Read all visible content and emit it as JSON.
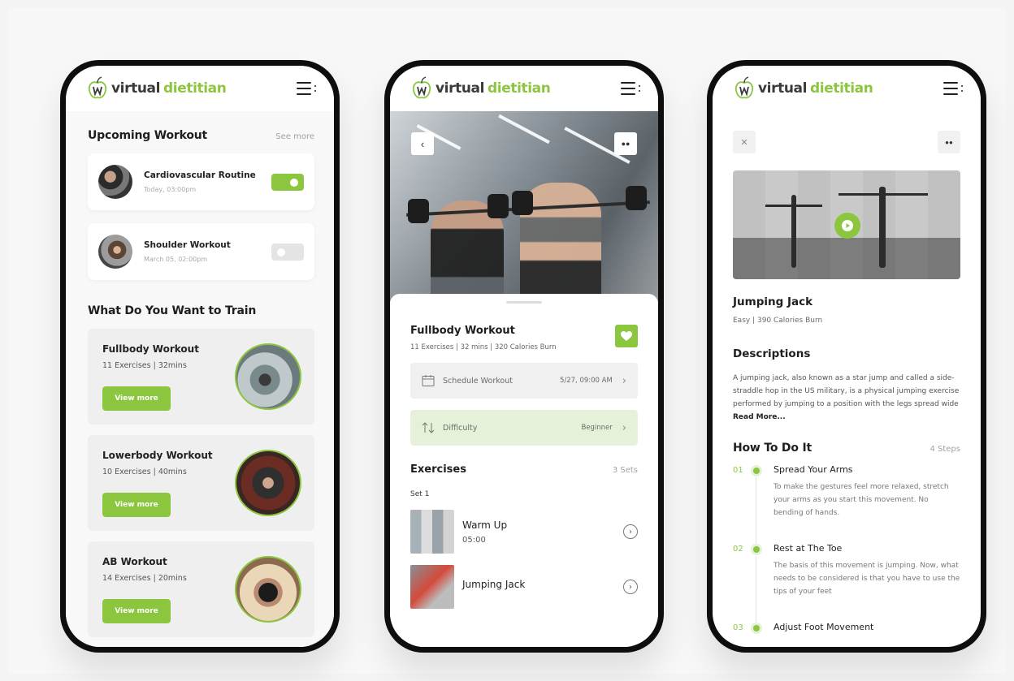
{
  "brand": {
    "word1": "virtual",
    "word2": "dietitian"
  },
  "colors": {
    "accent": "#8cc63f",
    "accent_light": "#e6f1d9"
  },
  "screen1": {
    "upcoming_title": "Upcoming Workout",
    "see_more": "See more",
    "workouts": [
      {
        "name": "Cardiovascular Routine",
        "time": "Today, 03:00pm",
        "enabled": true
      },
      {
        "name": "Shoulder Workout",
        "time": "March 05, 02:00pm",
        "enabled": false
      }
    ],
    "train_title": "What Do You Want to Train",
    "trainings": [
      {
        "name": "Fullbody Workout",
        "meta": "11 Exercises | 32mins",
        "button": "View more"
      },
      {
        "name": "Lowerbody Workout",
        "meta": "10 Exercises | 40mins",
        "button": "View more"
      },
      {
        "name": "AB Workout",
        "meta": "14 Exercises | 20mins",
        "button": "View more"
      }
    ]
  },
  "screen2": {
    "title": "Fullbody Workout",
    "meta": "11 Exercises | 32 mins | 320 Calories Burn",
    "schedule": {
      "label": "Schedule Workout",
      "value": "5/27, 09:00 AM"
    },
    "difficulty": {
      "label": "Difficulty",
      "value": "Beginner"
    },
    "exercises_title": "Exercises",
    "exercises_count": "3 Sets",
    "set_label": "Set 1",
    "exercises": [
      {
        "name": "Warm Up",
        "duration": "05:00"
      },
      {
        "name": "Jumping Jack",
        "duration": ""
      }
    ]
  },
  "screen3": {
    "title": "Jumping Jack",
    "meta": "Easy | 390 Calories Burn",
    "desc_title": "Descriptions",
    "desc_text": "A jumping jack, also known as a star jump and called a side-straddle hop in the US military, is a physical jumping exercise performed by jumping to a position with the legs spread wide ",
    "read_more": "Read More...",
    "how_title": "How To Do It",
    "steps_count": "4 Steps",
    "steps": [
      {
        "num": "01",
        "name": "Spread Your Arms",
        "text": "To make the gestures feel more relaxed, stretch your arms as you start this movement. No bending of hands."
      },
      {
        "num": "02",
        "name": "Rest at The Toe",
        "text": "The basis of this movement is jumping. Now, what needs to be considered is that you have to use the tips of your feet"
      },
      {
        "num": "03",
        "name": "Adjust Foot Movement",
        "text": ""
      }
    ]
  }
}
